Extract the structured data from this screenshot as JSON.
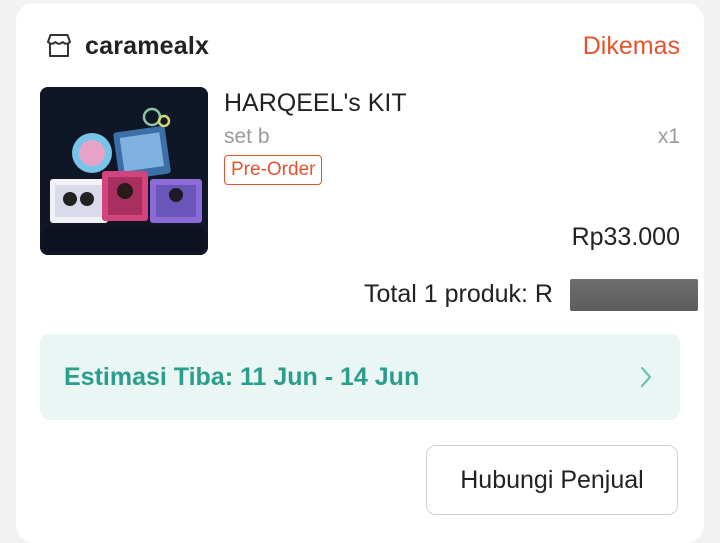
{
  "shop": {
    "name": "caramealx",
    "icon": "store-icon",
    "status": "Dikemas",
    "status_color": "#e2542d"
  },
  "product": {
    "title": "HARQEEL's KIT",
    "variant": "set b",
    "quantity": "x1",
    "badge": "Pre-Order",
    "price": "Rp33.000",
    "image": "product-photo"
  },
  "summary": {
    "total_label": "Total 1 produk: R"
  },
  "delivery": {
    "estimate": "Estimasi Tiba: 11 Jun - 14 Jun",
    "icon": "chevron-right-icon",
    "accent_color": "#2a9d8f"
  },
  "actions": {
    "contact_seller": "Hubungi Penjual"
  }
}
